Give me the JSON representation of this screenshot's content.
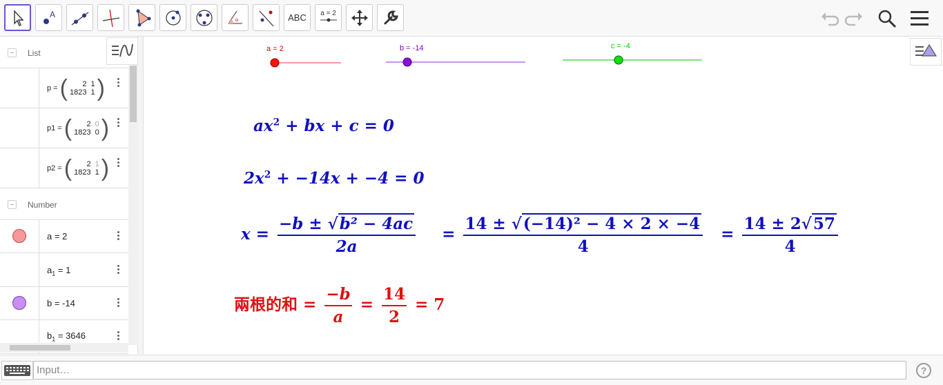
{
  "toolbar": {
    "tools": [
      {
        "name": "move-tool"
      },
      {
        "name": "point-tool"
      },
      {
        "name": "line-tool"
      },
      {
        "name": "perpendicular-tool"
      },
      {
        "name": "polygon-tool"
      },
      {
        "name": "circle-tool"
      },
      {
        "name": "circle-3points-tool"
      },
      {
        "name": "angle-tool"
      },
      {
        "name": "reflect-tool"
      },
      {
        "name": "text-tool",
        "label": "ABC"
      },
      {
        "name": "slider-tool",
        "label": "a = 2"
      },
      {
        "name": "move-view-tool"
      },
      {
        "name": "settings-tool"
      }
    ]
  },
  "algebra": {
    "list_group": "List",
    "number_group": "Number",
    "matrices": [
      {
        "name": "p",
        "rows": [
          [
            "2",
            "1"
          ],
          [
            "1823",
            "1"
          ]
        ]
      },
      {
        "name": "p1",
        "rows": [
          [
            "2",
            "0"
          ],
          [
            "1823",
            "0"
          ]
        ]
      },
      {
        "name": "p2",
        "rows": [
          [
            "2",
            "1"
          ],
          [
            "1823",
            "1"
          ]
        ]
      }
    ],
    "numbers": [
      {
        "text": "a = 2",
        "color": "#f49a9a"
      },
      {
        "text": "a",
        "sub": "1",
        "rest": " = 1"
      },
      {
        "text": "b = -14",
        "color": "#c98ff4"
      },
      {
        "text": "b",
        "sub": "1",
        "rest": " = 3646"
      }
    ]
  },
  "sliders": [
    {
      "label": "a = 2",
      "color": "#ff0000",
      "line": "#f48a8a"
    },
    {
      "label": "b = -14",
      "color": "#8800cc",
      "line": "#c890f4"
    },
    {
      "label": "c = -4",
      "color": "#00cc00",
      "line": "#80e080"
    }
  ],
  "formulas": {
    "general": {
      "a": "ax",
      "exp": "2",
      "rest": " + bx + c = 0"
    },
    "specific": {
      "a": "2x",
      "exp": "2",
      "rest": " + −14x + −4 = 0"
    },
    "roots": {
      "lhs": "x =",
      "num1": "−b ± ",
      "rad1": "b² − 4ac",
      "den1": "2a",
      "eq2": "=",
      "num2": "14 ± ",
      "rad2": "(−14)² − 4 × 2 × −4",
      "den2": "4",
      "eq3": "=",
      "num3": "14 ± 2",
      "rad3": "57",
      "den3": "4"
    },
    "sum": {
      "label": "兩根的和",
      "eq1": "=",
      "n1": "−b",
      "d1": "a",
      "eq2": "=",
      "n2": "14",
      "d2": "2",
      "eq3": "= 7"
    }
  },
  "input": {
    "placeholder": "Input…"
  },
  "help": "?",
  "colors": {
    "accent": "#6557d2",
    "formula_blue": "#1010c0",
    "formula_red": "#e01010"
  }
}
